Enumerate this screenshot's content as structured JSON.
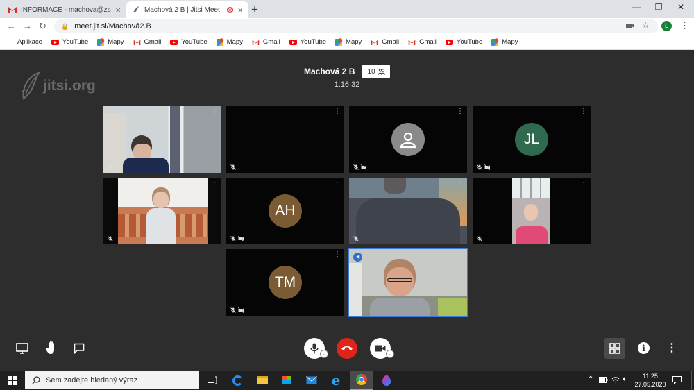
{
  "tabs": [
    {
      "title": "INFORMACE - machova@zsunes",
      "close": "×"
    },
    {
      "title": "Machová 2 B | Jitsi Meet",
      "close": "×"
    }
  ],
  "new_tab_label": "+",
  "url": "meet.jit.si/Machová2.B",
  "profile_initial": "L",
  "bookmarks": [
    {
      "label": "Aplikace",
      "icon": "apps-icon"
    },
    {
      "label": "YouTube",
      "icon": "youtube-icon"
    },
    {
      "label": "Mapy",
      "icon": "maps-icon"
    },
    {
      "label": "Gmail",
      "icon": "gmail-icon"
    },
    {
      "label": "YouTube",
      "icon": "youtube-icon"
    },
    {
      "label": "Mapy",
      "icon": "maps-icon"
    },
    {
      "label": "Gmail",
      "icon": "gmail-icon"
    },
    {
      "label": "YouTube",
      "icon": "youtube-icon"
    },
    {
      "label": "Mapy",
      "icon": "maps-icon"
    },
    {
      "label": "Gmail",
      "icon": "gmail-icon"
    },
    {
      "label": "Gmail",
      "icon": "gmail-icon"
    },
    {
      "label": "YouTube",
      "icon": "youtube-icon"
    },
    {
      "label": "Mapy",
      "icon": "maps-icon"
    }
  ],
  "jitsi": {
    "logo_text": "jitsi.org",
    "meeting_name": "Machová 2 B",
    "participant_count": "10",
    "duration": "1:16:32",
    "tiles": [
      {
        "kind": "video-boy",
        "menu": "⋮"
      },
      {
        "kind": "blank",
        "menu": "⋮"
      },
      {
        "kind": "generic-avatar",
        "menu": "⋮"
      },
      {
        "kind": "initials",
        "initials": "JL",
        "color": "#2f6a50",
        "menu": "⋮"
      },
      {
        "kind": "video-girl-sofa",
        "menu": "⋮"
      },
      {
        "kind": "initials",
        "initials": "AH",
        "color": "#7a5b33",
        "menu": "⋮"
      },
      {
        "kind": "video-dim-person",
        "menu": "⋮"
      },
      {
        "kind": "video-girl-window",
        "menu": "⋮"
      },
      {
        "kind": "initials",
        "initials": "TM",
        "color": "#7a5b33",
        "menu": "⋮"
      },
      {
        "kind": "video-teacher",
        "menu": ""
      }
    ],
    "accent": "#3c7ddb",
    "hangup_color": "#e2231a"
  },
  "taskbar": {
    "search_placeholder": "Sem zadejte hledaný výraz",
    "time": "11:25",
    "date": "27.05.2020"
  }
}
